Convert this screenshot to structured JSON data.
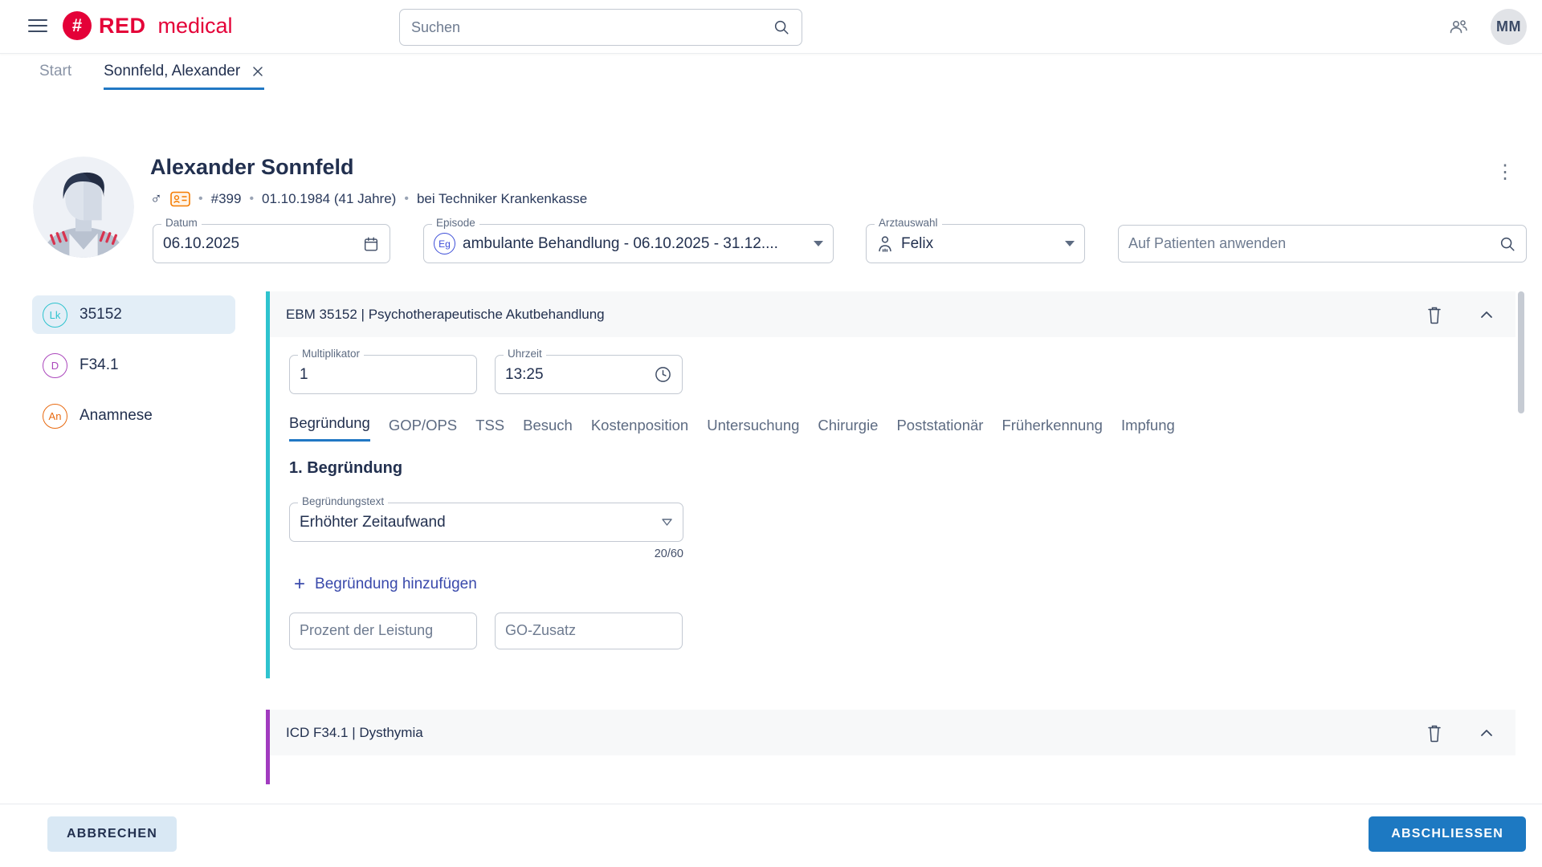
{
  "colors": {
    "brand_red": "#e40138",
    "accent_blue": "#2178c4",
    "teal": "#2ec3ce",
    "purple": "#ab47bc",
    "orange": "#e86a10",
    "indigo_link": "#3949ab"
  },
  "topbar": {
    "brand_red_text": "RED",
    "brand_medical_text": "medical",
    "brand_symbol": "#",
    "search_placeholder": "Suchen",
    "avatar_initials": "MM"
  },
  "tabstrip": {
    "start_label": "Start",
    "active_tab_label": "Sonnfeld, Alexander"
  },
  "patient": {
    "name": "Alexander Sonnfeld",
    "gender_symbol": "♂",
    "id": "#399",
    "birth": "01.10.1984 (41 Jahre)",
    "insurance": "bei Techniker Krankenkasse",
    "sep": "•",
    "kebab": "⋮"
  },
  "filters": {
    "datum_label": "Datum",
    "datum_value": "06.10.2025",
    "episode_label": "Episode",
    "episode_badge": "Eg",
    "episode_value": "ambulante Behandlung - 06.10.2025 - 31.12....",
    "arzt_label": "Arztauswahl",
    "arzt_value": "Felix",
    "apply_placeholder": "Auf Patienten anwenden"
  },
  "sidebar": {
    "items": [
      {
        "badge": "Lk",
        "label": "35152"
      },
      {
        "badge": "D",
        "label": "F34.1"
      },
      {
        "badge": "An",
        "label": "Anamnese"
      }
    ]
  },
  "ebm_card": {
    "title": "EBM 35152 | Psychotherapeutische Akutbehandlung",
    "multiplikator_label": "Multiplikator",
    "multiplikator_value": "1",
    "uhrzeit_label": "Uhrzeit",
    "uhrzeit_value": "13:25",
    "tabs": [
      "Begründung",
      "GOP/OPS",
      "TSS",
      "Besuch",
      "Kostenposition",
      "Untersuchung",
      "Chirurgie",
      "Poststationär",
      "Früherkennung",
      "Impfung"
    ],
    "section_heading": "1. Begründung",
    "begruendung_label": "Begründungstext",
    "begruendung_value": "Erhöhter Zeitaufwand",
    "char_counter": "20/60",
    "add_plus": "+",
    "add_link_label": "Begründung hinzufügen",
    "prozent_placeholder": "Prozent der Leistung",
    "go_zusatz_placeholder": "GO-Zusatz"
  },
  "icd_card": {
    "title": "ICD F34.1 | Dysthymia"
  },
  "footer": {
    "cancel_label": "ABBRECHEN",
    "submit_label": "ABSCHLIESSEN"
  }
}
